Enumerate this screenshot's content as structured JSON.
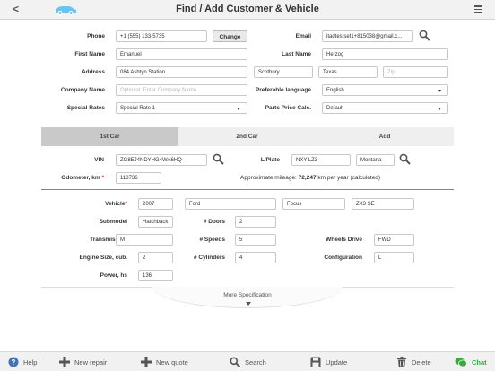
{
  "header": {
    "back_glyph": "<",
    "title": "Find / Add Customer & Vehicle"
  },
  "form": {
    "phone": {
      "label": "Phone",
      "value": "+1 (555) 133-5735",
      "change_label": "Change"
    },
    "email": {
      "label": "Email",
      "value": "itadtestset1+815038@gmail.c..."
    },
    "first_name": {
      "label": "First Name",
      "value": "Emanuel"
    },
    "last_name": {
      "label": "Last Name",
      "value": "Herzog"
    },
    "address": {
      "label": "Address",
      "street": "084 Ashtyn Station",
      "city": "Scotbury",
      "state": "Texas",
      "zip_placeholder": "Zip"
    },
    "company": {
      "label": "Company Name",
      "placeholder": "Optional: Enter Company Name"
    },
    "language": {
      "label": "Preferable language",
      "value": "English"
    },
    "special_rates": {
      "label": "Special Rates",
      "value": "Special Rate 1"
    },
    "parts_price": {
      "label": "Parts Price Calc.",
      "value": "Default"
    }
  },
  "tabs": [
    "1st Car",
    "2nd Car",
    "Add"
  ],
  "vehicle": {
    "vin_label": "VIN",
    "vin": "ZG8EJ4NDYHG4WA6HQ",
    "plate_label": "L/Plate",
    "plate": "NXY-LZ3",
    "plate_state": "Montana",
    "odometer_label": "Odometer, km",
    "odometer": "118736",
    "mileage_prefix": "Approximate mileage: ",
    "mileage_value": "72,247",
    "mileage_suffix": " km per year (calculated)",
    "vehicle_label": "Vehicle",
    "year": "2007",
    "make": "Ford",
    "model": "Focus",
    "trim": "ZX3 SE",
    "submodel_label": "Submodel",
    "submodel": "Hatchback",
    "doors_label": "# Doors",
    "doors": "2",
    "transmission_label": "Transmission",
    "transmission": "M",
    "speeds_label": "# Speeds",
    "speeds": "5",
    "wheels_label": "Wheels Drive",
    "wheels": "FWD",
    "engine_label": "Engine Size, cub.",
    "engine": "2",
    "cylinders_label": "# Cylinders",
    "cylinders": "4",
    "config_label": "Configuration",
    "config": "L",
    "power_label": "Power, hs",
    "power": "136"
  },
  "more_spec": "More Specification",
  "toolbar": {
    "help": "Help",
    "new_repair": "New repair",
    "new_quote": "New quote",
    "search": "Search",
    "update": "Update",
    "delete": "Delete",
    "chat": "Chat"
  },
  "colors": {
    "chat_green": "#3aa843",
    "help_blue": "#3f72b8",
    "logo_blue": "#6fc3ea"
  }
}
